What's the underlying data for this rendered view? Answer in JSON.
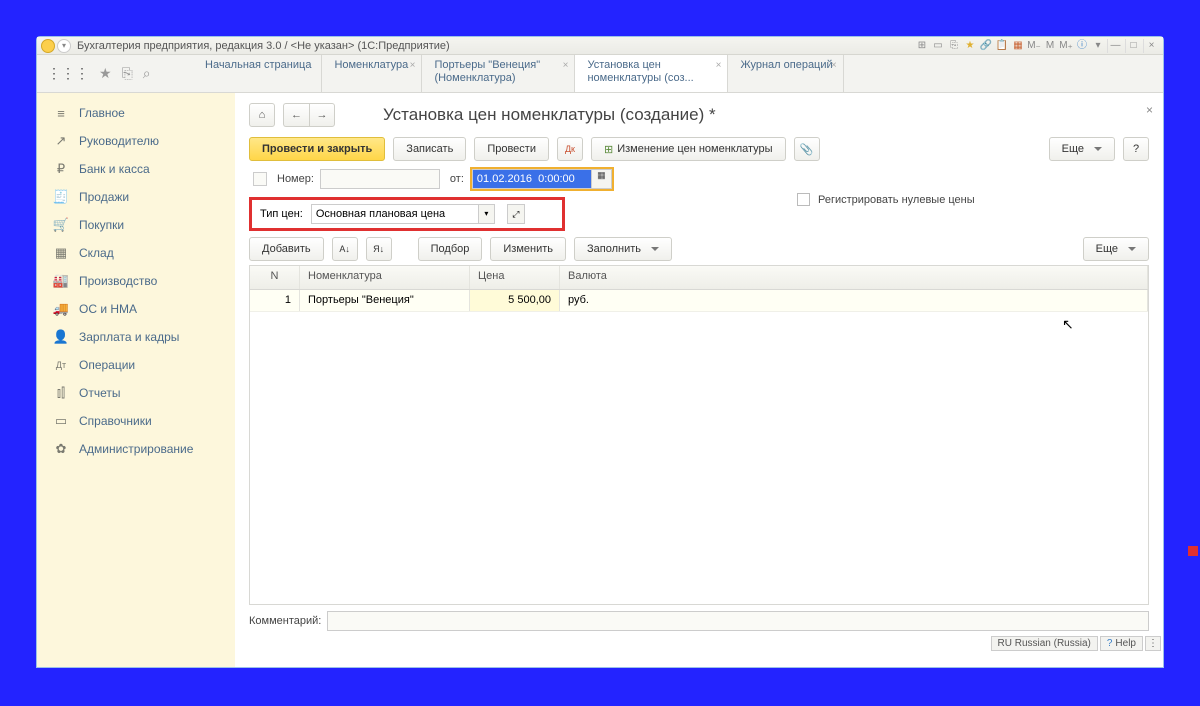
{
  "window": {
    "title": "Бухгалтерия предприятия, редакция 3.0 / <Не указан>   (1С:Предприятие)"
  },
  "toolbar_icons": {
    "menu": "⋮⋮⋮",
    "star": "★",
    "clipboard": "⎘",
    "search": "⌕"
  },
  "tabs": [
    {
      "label": "Начальная страница",
      "closable": false
    },
    {
      "label": "Номенклатура",
      "closable": true
    },
    {
      "label": "Портьеры \"Венеция\" (Номенклатура)",
      "closable": true
    },
    {
      "label": "Установка цен номенклатуры (соз...",
      "closable": true,
      "active": true
    },
    {
      "label": "Журнал операций",
      "closable": true
    }
  ],
  "sidebar": [
    {
      "icon": "≡",
      "label": "Главное"
    },
    {
      "icon": "↗",
      "label": "Руководителю"
    },
    {
      "icon": "₽",
      "label": "Банк и касса"
    },
    {
      "icon": "🧾",
      "label": "Продажи"
    },
    {
      "icon": "🛒",
      "label": "Покупки"
    },
    {
      "icon": "▦",
      "label": "Склад"
    },
    {
      "icon": "🏭",
      "label": "Производство"
    },
    {
      "icon": "🚚",
      "label": "ОС и НМА"
    },
    {
      "icon": "👤",
      "label": "Зарплата и кадры"
    },
    {
      "icon": "Дт",
      "label": "Операции"
    },
    {
      "icon": "⫾⫿",
      "label": "Отчеты"
    },
    {
      "icon": "▭",
      "label": "Справочники"
    },
    {
      "icon": "✿",
      "label": "Администрирование"
    }
  ],
  "page": {
    "title": "Установка цен номенклатуры (создание) *"
  },
  "cmd": {
    "post_close": "Провести и закрыть",
    "save": "Записать",
    "post": "Провести",
    "price_change": "Изменение цен номенклатуры",
    "more": "Еще",
    "help": "?"
  },
  "form": {
    "num_label": "Номер:",
    "from_label": "от:",
    "date": "01.02.2016  0:00:00",
    "type_label": "Тип цен:",
    "type_value": "Основная плановая цена",
    "reg_zero": "Регистрировать нулевые цены"
  },
  "tbl_cmd": {
    "add": "Добавить",
    "select": "Подбор",
    "change": "Изменить",
    "fill": "Заполнить",
    "more": "Еще"
  },
  "grid": {
    "head": {
      "n": "N",
      "nom": "Номенклатура",
      "price": "Цена",
      "cur": "Валюта"
    },
    "rows": [
      {
        "n": "1",
        "nom": "Портьеры \"Венеция\"",
        "price": "5 500,00",
        "cur": "руб."
      }
    ]
  },
  "comment": {
    "label": "Комментарий:"
  },
  "status": {
    "locale": "RU Russian (Russia)",
    "help": "Help"
  }
}
